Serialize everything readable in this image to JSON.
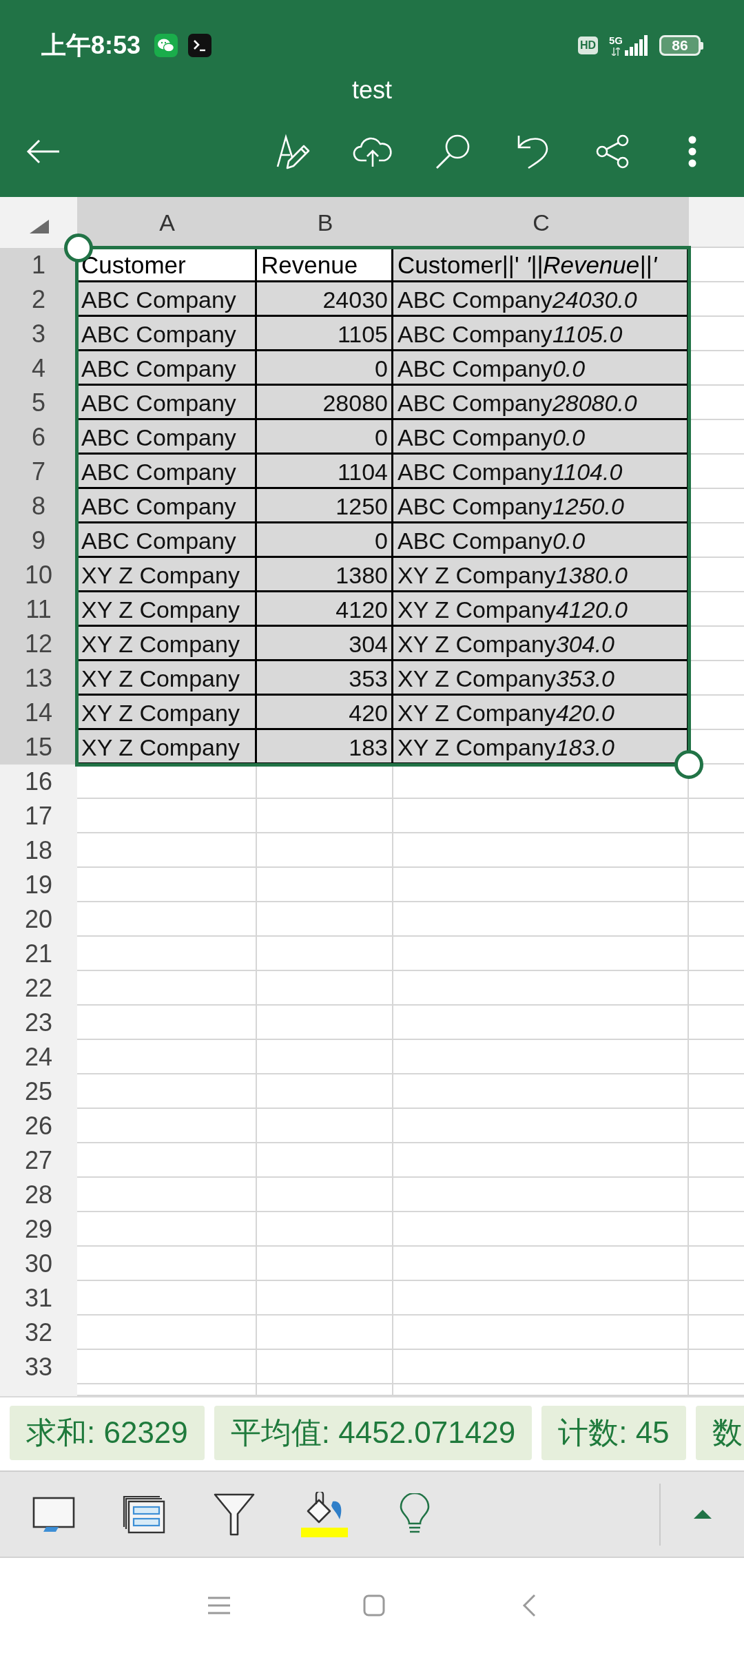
{
  "status_bar": {
    "time": "上午8:53",
    "hd": "HD",
    "network": "5G",
    "battery": "86"
  },
  "app_bar": {
    "title": "test"
  },
  "sheet": {
    "columns": [
      {
        "label": "A",
        "selected": true,
        "kind": "text"
      },
      {
        "label": "B",
        "selected": true,
        "kind": "number"
      },
      {
        "label": "C",
        "selected": true,
        "kind": "text"
      }
    ],
    "rows": [
      {
        "number": "1",
        "selected": true,
        "kind": "header",
        "cells": [
          {
            "text": "Customer",
            "shaded": false
          },
          {
            "text": "Revenue",
            "shaded": false
          },
          {
            "text": "Customer||' *'||Revenue||'*",
            "shaded": true
          }
        ]
      },
      {
        "number": "2",
        "selected": true,
        "kind": "data",
        "cells": [
          {
            "text": "ABC Company",
            "shaded": true
          },
          {
            "text": "24030",
            "shaded": true
          },
          {
            "text": "ABC Company",
            "suffix": "24030.0",
            "shaded": true
          }
        ]
      },
      {
        "number": "3",
        "selected": true,
        "kind": "data",
        "cells": [
          {
            "text": "ABC Company",
            "shaded": true
          },
          {
            "text": "1105",
            "shaded": true
          },
          {
            "text": "ABC Company",
            "suffix": "1105.0",
            "shaded": true
          }
        ]
      },
      {
        "number": "4",
        "selected": true,
        "kind": "data",
        "cells": [
          {
            "text": "ABC Company",
            "shaded": true
          },
          {
            "text": "0",
            "shaded": true
          },
          {
            "text": "ABC Company",
            "suffix": "0.0",
            "shaded": true
          }
        ]
      },
      {
        "number": "5",
        "selected": true,
        "kind": "data",
        "cells": [
          {
            "text": "ABC Company",
            "shaded": true
          },
          {
            "text": "28080",
            "shaded": true
          },
          {
            "text": "ABC Company",
            "suffix": "28080.0",
            "shaded": true
          }
        ]
      },
      {
        "number": "6",
        "selected": true,
        "kind": "data",
        "cells": [
          {
            "text": "ABC Company",
            "shaded": true
          },
          {
            "text": "0",
            "shaded": true
          },
          {
            "text": "ABC Company",
            "suffix": "0.0",
            "shaded": true
          }
        ]
      },
      {
        "number": "7",
        "selected": true,
        "kind": "data",
        "cells": [
          {
            "text": "ABC Company",
            "shaded": true
          },
          {
            "text": "1104",
            "shaded": true
          },
          {
            "text": "ABC Company",
            "suffix": "1104.0",
            "shaded": true
          }
        ]
      },
      {
        "number": "8",
        "selected": true,
        "kind": "data",
        "cells": [
          {
            "text": "ABC Company",
            "shaded": true
          },
          {
            "text": "1250",
            "shaded": true
          },
          {
            "text": "ABC Company",
            "suffix": "1250.0",
            "shaded": true
          }
        ]
      },
      {
        "number": "9",
        "selected": true,
        "kind": "data",
        "cells": [
          {
            "text": "ABC Company",
            "shaded": true
          },
          {
            "text": "0",
            "shaded": true
          },
          {
            "text": "ABC Company",
            "suffix": "0.0",
            "shaded": true
          }
        ]
      },
      {
        "number": "10",
        "selected": true,
        "kind": "data",
        "cells": [
          {
            "text": "XY Z Company",
            "shaded": true
          },
          {
            "text": "1380",
            "shaded": true
          },
          {
            "text": "XY Z Company",
            "suffix": "1380.0",
            "shaded": true
          }
        ]
      },
      {
        "number": "11",
        "selected": true,
        "kind": "data",
        "cells": [
          {
            "text": "XY Z Company",
            "shaded": true
          },
          {
            "text": "4120",
            "shaded": true
          },
          {
            "text": "XY Z Company",
            "suffix": "4120.0",
            "shaded": true
          }
        ]
      },
      {
        "number": "12",
        "selected": true,
        "kind": "data",
        "cells": [
          {
            "text": "XY Z Company",
            "shaded": true
          },
          {
            "text": "304",
            "shaded": true
          },
          {
            "text": "XY Z Company",
            "suffix": "304.0",
            "shaded": true
          }
        ]
      },
      {
        "number": "13",
        "selected": true,
        "kind": "data",
        "cells": [
          {
            "text": "XY Z Company",
            "shaded": true
          },
          {
            "text": "353",
            "shaded": true
          },
          {
            "text": "XY Z Company",
            "suffix": "353.0",
            "shaded": true
          }
        ]
      },
      {
        "number": "14",
        "selected": true,
        "kind": "data",
        "cells": [
          {
            "text": "XY Z Company",
            "shaded": true
          },
          {
            "text": "420",
            "shaded": true
          },
          {
            "text": "XY Z Company",
            "suffix": "420.0",
            "shaded": true
          }
        ]
      },
      {
        "number": "15",
        "selected": true,
        "kind": "data",
        "cells": [
          {
            "text": "XY Z Company",
            "shaded": true
          },
          {
            "text": "183",
            "shaded": true
          },
          {
            "text": "XY Z Company",
            "suffix": "183.0",
            "shaded": true
          }
        ]
      },
      {
        "number": "16",
        "selected": false,
        "kind": "blank"
      },
      {
        "number": "17",
        "selected": false,
        "kind": "blank"
      },
      {
        "number": "18",
        "selected": false,
        "kind": "blank"
      },
      {
        "number": "19",
        "selected": false,
        "kind": "blank"
      },
      {
        "number": "20",
        "selected": false,
        "kind": "blank"
      },
      {
        "number": "21",
        "selected": false,
        "kind": "blank"
      },
      {
        "number": "22",
        "selected": false,
        "kind": "blank"
      },
      {
        "number": "23",
        "selected": false,
        "kind": "blank"
      },
      {
        "number": "24",
        "selected": false,
        "kind": "blank"
      },
      {
        "number": "25",
        "selected": false,
        "kind": "blank"
      },
      {
        "number": "26",
        "selected": false,
        "kind": "blank"
      },
      {
        "number": "27",
        "selected": false,
        "kind": "blank"
      },
      {
        "number": "28",
        "selected": false,
        "kind": "blank"
      },
      {
        "number": "29",
        "selected": false,
        "kind": "blank"
      },
      {
        "number": "30",
        "selected": false,
        "kind": "blank"
      },
      {
        "number": "31",
        "selected": false,
        "kind": "blank"
      },
      {
        "number": "32",
        "selected": false,
        "kind": "blank"
      },
      {
        "number": "33",
        "selected": false,
        "kind": "blank"
      }
    ]
  },
  "summary": [
    "求和: 62329",
    "平均值: 4452.071429",
    "计数: 45",
    "数"
  ]
}
